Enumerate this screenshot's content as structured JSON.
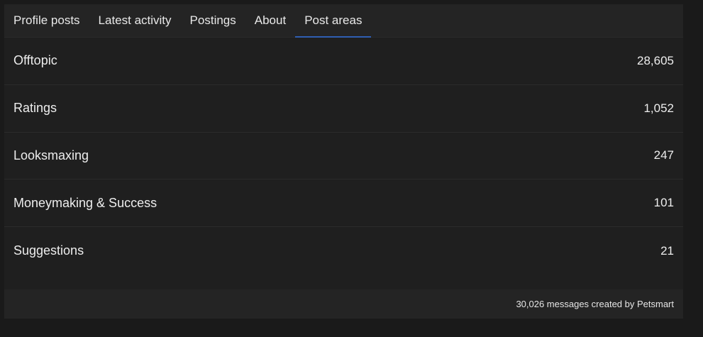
{
  "tabs": [
    {
      "label": "Profile posts",
      "active": false
    },
    {
      "label": "Latest activity",
      "active": false
    },
    {
      "label": "Postings",
      "active": false
    },
    {
      "label": "About",
      "active": false
    },
    {
      "label": "Post areas",
      "active": true
    }
  ],
  "post_areas": [
    {
      "name": "Offtopic",
      "count": "28,605"
    },
    {
      "name": "Ratings",
      "count": "1,052"
    },
    {
      "name": "Looksmaxing",
      "count": "247"
    },
    {
      "name": "Moneymaking & Success",
      "count": "101"
    },
    {
      "name": "Suggestions",
      "count": "21"
    }
  ],
  "footer": {
    "summary": "30,026 messages created by Petsmart"
  },
  "colors": {
    "accent": "#2f5fb3",
    "background": "#1a1a1a",
    "panel": "#1f1f1f"
  }
}
